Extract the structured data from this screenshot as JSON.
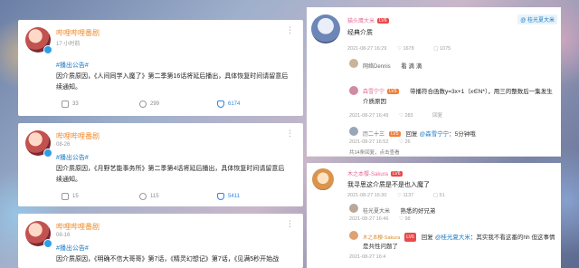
{
  "posts": [
    {
      "name": "哔哩哔哩番剧",
      "time": "17 小时前",
      "tag": "#播出公告#",
      "text": "因介质原因，《人间同学入魔了》第二季第16话将延后播出，具体恢复时间请留意后续通知。",
      "reposts": "33",
      "comments": "299",
      "likes": "6174"
    },
    {
      "name": "哔哩哔哩番剧",
      "time": "08-26",
      "tag": "#播出公告#",
      "text": "因介质原因，《月野艺能事务所》第二季第4话将延后播出，具体恢复时间请留意后续通知。",
      "reposts": "15",
      "comments": "115",
      "likes": "5411"
    },
    {
      "name": "哔哩哔哩番剧",
      "time": "08-16",
      "tag": "#播出公告#",
      "text": "因介质原因，《明确不信大哥哥》第7话，《精灵幻想记》第7话，《见满5秒开始战",
      "reposts": "",
      "comments": "",
      "likes": ""
    }
  ],
  "comments_panel": {
    "top_badge": "@ 桂光夏大米",
    "c1": {
      "name": "猫头鹰大米",
      "level": "LV6",
      "text": "经典介质",
      "date": "2021-08-27 16:29",
      "likes": "1678",
      "replies": "1075",
      "sub_name": "网络Dennis",
      "sub_text": "看 滴 滴"
    },
    "c2": {
      "name": "森雪宁宁",
      "level": "LV5",
      "text": "带播符合函数y=3x+1（x∈N*），用三的整数后一集发生介质原因",
      "date": "2021-08-27 16:49",
      "likes": "283",
      "replies": "回复"
    },
    "c3": {
      "name": "历二十三",
      "level": "LV5",
      "reply_label": "回复",
      "mention": "@森雪宁宁",
      "text": "：5分钟哦",
      "date": "2021-08-27 16:52",
      "likes": "26",
      "more": "共14条回复，点击查看"
    },
    "c4": {
      "name": "木之本樱-Sakura",
      "level": "LV6",
      "text": "我寻思这介质是不是也入魔了",
      "date": "2021-08-27 16:30",
      "likes": "1137",
      "replies": "51",
      "sub_name": "桂光夏大米",
      "sub_text": "熟悉的好兄弟",
      "sub_date": "2021-08-27 16:46",
      "sub_likes": "98"
    },
    "c5": {
      "name": "木之本樱-Sakura",
      "level": "LV6",
      "reply_label": "回复",
      "mention": "@桂光夏大米",
      "text": "：其实我不看这番的hh 但这事情是共性问题了",
      "date": "2021-08-27 16:4"
    }
  },
  "colors": {
    "name_orange": "#f08a2b",
    "link_blue": "#1a7ac7",
    "pink_name": "#e36f9a"
  },
  "icons": [
    "repost-icon",
    "comment-icon",
    "like-icon",
    "more-icon",
    "verified-badge-icon"
  ]
}
